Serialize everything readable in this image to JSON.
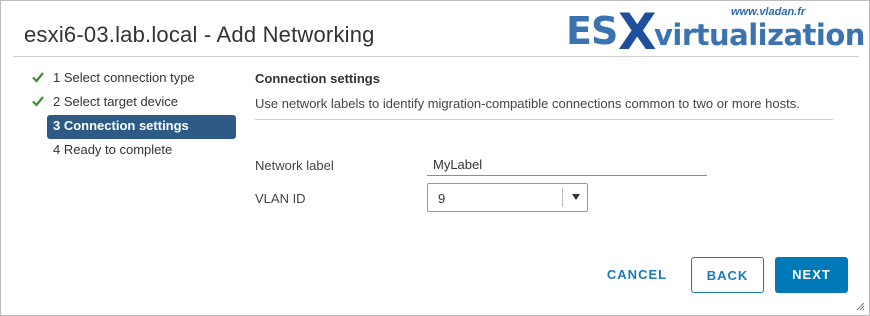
{
  "dialog": {
    "title": "esxi6-03.lab.local - Add Networking"
  },
  "watermark": {
    "url": "www.vladan.fr",
    "brand_prefix": "ES",
    "brand_x": "X",
    "brand_suffix": "virtualization"
  },
  "steps": [
    {
      "label": "1 Select connection type",
      "status": "completed",
      "icon": "check-icon"
    },
    {
      "label": "2 Select target device",
      "status": "completed",
      "icon": "check-icon"
    },
    {
      "label": "3 Connection settings",
      "status": "active"
    },
    {
      "label": "4 Ready to complete",
      "status": "pending"
    }
  ],
  "section": {
    "title": "Connection settings",
    "description": "Use network labels to identify migration-compatible connections common to two or more hosts."
  },
  "form": {
    "network_label_label": "Network label",
    "network_label_value": "MyLabel",
    "vlan_label": "VLAN ID",
    "vlan_value": "9"
  },
  "buttons": {
    "cancel": "CANCEL",
    "back": "BACK",
    "next": "NEXT"
  },
  "colors": {
    "accent": "#0079b8",
    "active_step": "#2d5b86",
    "check": "#3c8d2f"
  }
}
